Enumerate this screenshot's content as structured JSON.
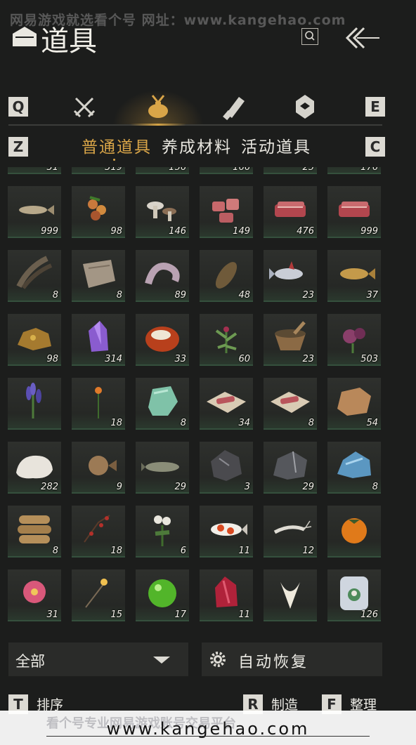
{
  "watermark": {
    "top": "网易游戏就选看个号  网址：www.kangehao.com",
    "bottom_faint": "看个号专业网易游戏账号交易平台",
    "url": "www.kangehao.com"
  },
  "header": {
    "title": "道具",
    "search_icon": "search-icon",
    "back_icon": "back-chevron-icon"
  },
  "keys": {
    "q": "Q",
    "e": "E",
    "z": "Z",
    "c": "C",
    "t": "T",
    "r": "R",
    "f": "F"
  },
  "category_tabs": [
    {
      "icon": "crossed-swords-icon"
    },
    {
      "icon": "pouch-icon",
      "active": true
    },
    {
      "icon": "scroll-icon"
    },
    {
      "icon": "badge-icon"
    }
  ],
  "subtabs": [
    {
      "label": "普通道具",
      "active": true
    },
    {
      "label": "养成材料"
    },
    {
      "label": "活动道具"
    }
  ],
  "partial_row_counts": [
    "31",
    "319",
    "156",
    "166",
    "25",
    "176"
  ],
  "items": [
    {
      "icon": "fish-icon",
      "count": "999"
    },
    {
      "icon": "berries-icon",
      "count": "98"
    },
    {
      "icon": "mushrooms-icon",
      "count": "146"
    },
    {
      "icon": "meat-chunks-icon",
      "count": "149"
    },
    {
      "icon": "steak-icon",
      "count": "476"
    },
    {
      "icon": "steak-icon",
      "count": "999"
    },
    {
      "icon": "feathers-icon",
      "count": "8"
    },
    {
      "icon": "hide-icon",
      "count": "8"
    },
    {
      "icon": "tentacle-icon",
      "count": "89"
    },
    {
      "icon": "carp-icon",
      "count": "48"
    },
    {
      "icon": "tuna-icon",
      "count": "23"
    },
    {
      "icon": "golden-carp-icon",
      "count": "37"
    },
    {
      "icon": "ore-gold-icon",
      "count": "98"
    },
    {
      "icon": "amethyst-icon",
      "count": "314"
    },
    {
      "icon": "agate-icon",
      "count": "33"
    },
    {
      "icon": "herb-icon",
      "count": "60"
    },
    {
      "icon": "mortar-icon",
      "count": "23"
    },
    {
      "icon": "purple-flower-icon",
      "count": "503"
    },
    {
      "icon": "lavender-icon",
      "count": ""
    },
    {
      "icon": "orange-flower-icon",
      "count": "18"
    },
    {
      "icon": "jade-stone-icon",
      "count": "8"
    },
    {
      "icon": "meat-on-paper-icon",
      "count": "34"
    },
    {
      "icon": "meat-on-paper-icon",
      "count": "8"
    },
    {
      "icon": "fur-icon",
      "count": "54"
    },
    {
      "icon": "white-fluff-icon",
      "count": "282"
    },
    {
      "icon": "pufferfish-icon",
      "count": "9"
    },
    {
      "icon": "catfish-icon",
      "count": "29"
    },
    {
      "icon": "dark-ore-icon",
      "count": "3"
    },
    {
      "icon": "iron-ore-icon",
      "count": "29"
    },
    {
      "icon": "blue-crystal-icon",
      "count": "8"
    },
    {
      "icon": "sacks-icon",
      "count": "8"
    },
    {
      "icon": "red-berries-branch-icon",
      "count": "18"
    },
    {
      "icon": "white-flower-icon",
      "count": "6"
    },
    {
      "icon": "koi-icon",
      "count": "11"
    },
    {
      "icon": "shrimp-icon",
      "count": "12"
    },
    {
      "icon": "persimmon-icon",
      "count": ""
    },
    {
      "icon": "pink-flower-icon",
      "count": "31"
    },
    {
      "icon": "sparkler-icon",
      "count": "15"
    },
    {
      "icon": "green-orb-icon",
      "count": "17"
    },
    {
      "icon": "red-crystal-icon",
      "count": "11"
    },
    {
      "icon": "white-blossom-icon",
      "count": ""
    },
    {
      "icon": "ice-flower-icon",
      "count": "126"
    }
  ],
  "filter": {
    "label": "全部"
  },
  "auto_restore": {
    "label": "自动恢复",
    "icon": "gear-icon"
  },
  "actions": {
    "sort": "排序",
    "craft": "制造",
    "organize": "整理"
  }
}
